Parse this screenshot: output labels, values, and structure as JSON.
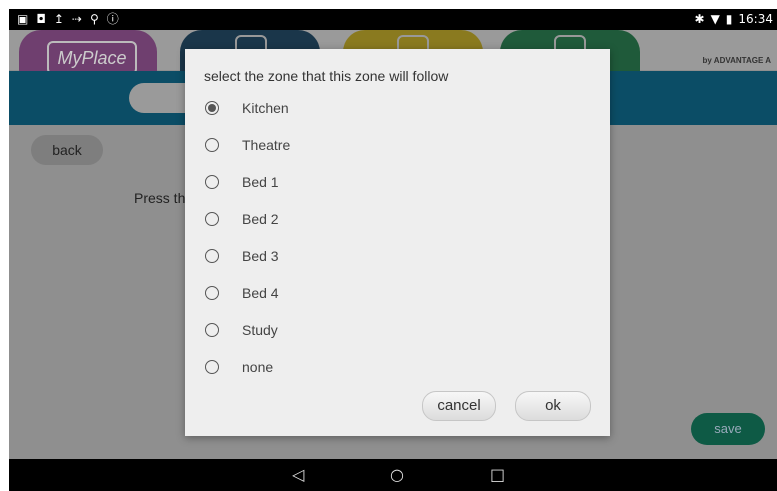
{
  "status_bar": {
    "time": "16:34",
    "left_icons": [
      "image-icon",
      "phone-icon",
      "upload-icon",
      "signal-icon",
      "usb-icon",
      "info-icon"
    ],
    "right_icons": [
      "bluetooth-icon",
      "wifi-icon",
      "battery-icon"
    ]
  },
  "header": {
    "logo_text": "MyPlace",
    "brand_text": "by ADVANTAGE A"
  },
  "page": {
    "back_label": "back",
    "press_text": "Press th",
    "save_label": "save"
  },
  "dialog": {
    "title": "select the zone that this zone will follow",
    "options": [
      "Kitchen",
      "Theatre",
      "Bed 1",
      "Bed 2",
      "Bed 3",
      "Bed 4",
      "Study",
      "none"
    ],
    "selected": "Kitchen",
    "cancel_label": "cancel",
    "ok_label": "ok"
  },
  "nav_bar": {
    "back_glyph": "◁",
    "home_glyph": "○",
    "recent_glyph": "□"
  },
  "colors": {
    "top_bar": "#0b4d66",
    "save_button": "#0e5a45",
    "tab1": "#6f3f6f",
    "tab2": "#1a364a",
    "tab3": "#8a7a1f",
    "tab4": "#1f5a3a"
  }
}
